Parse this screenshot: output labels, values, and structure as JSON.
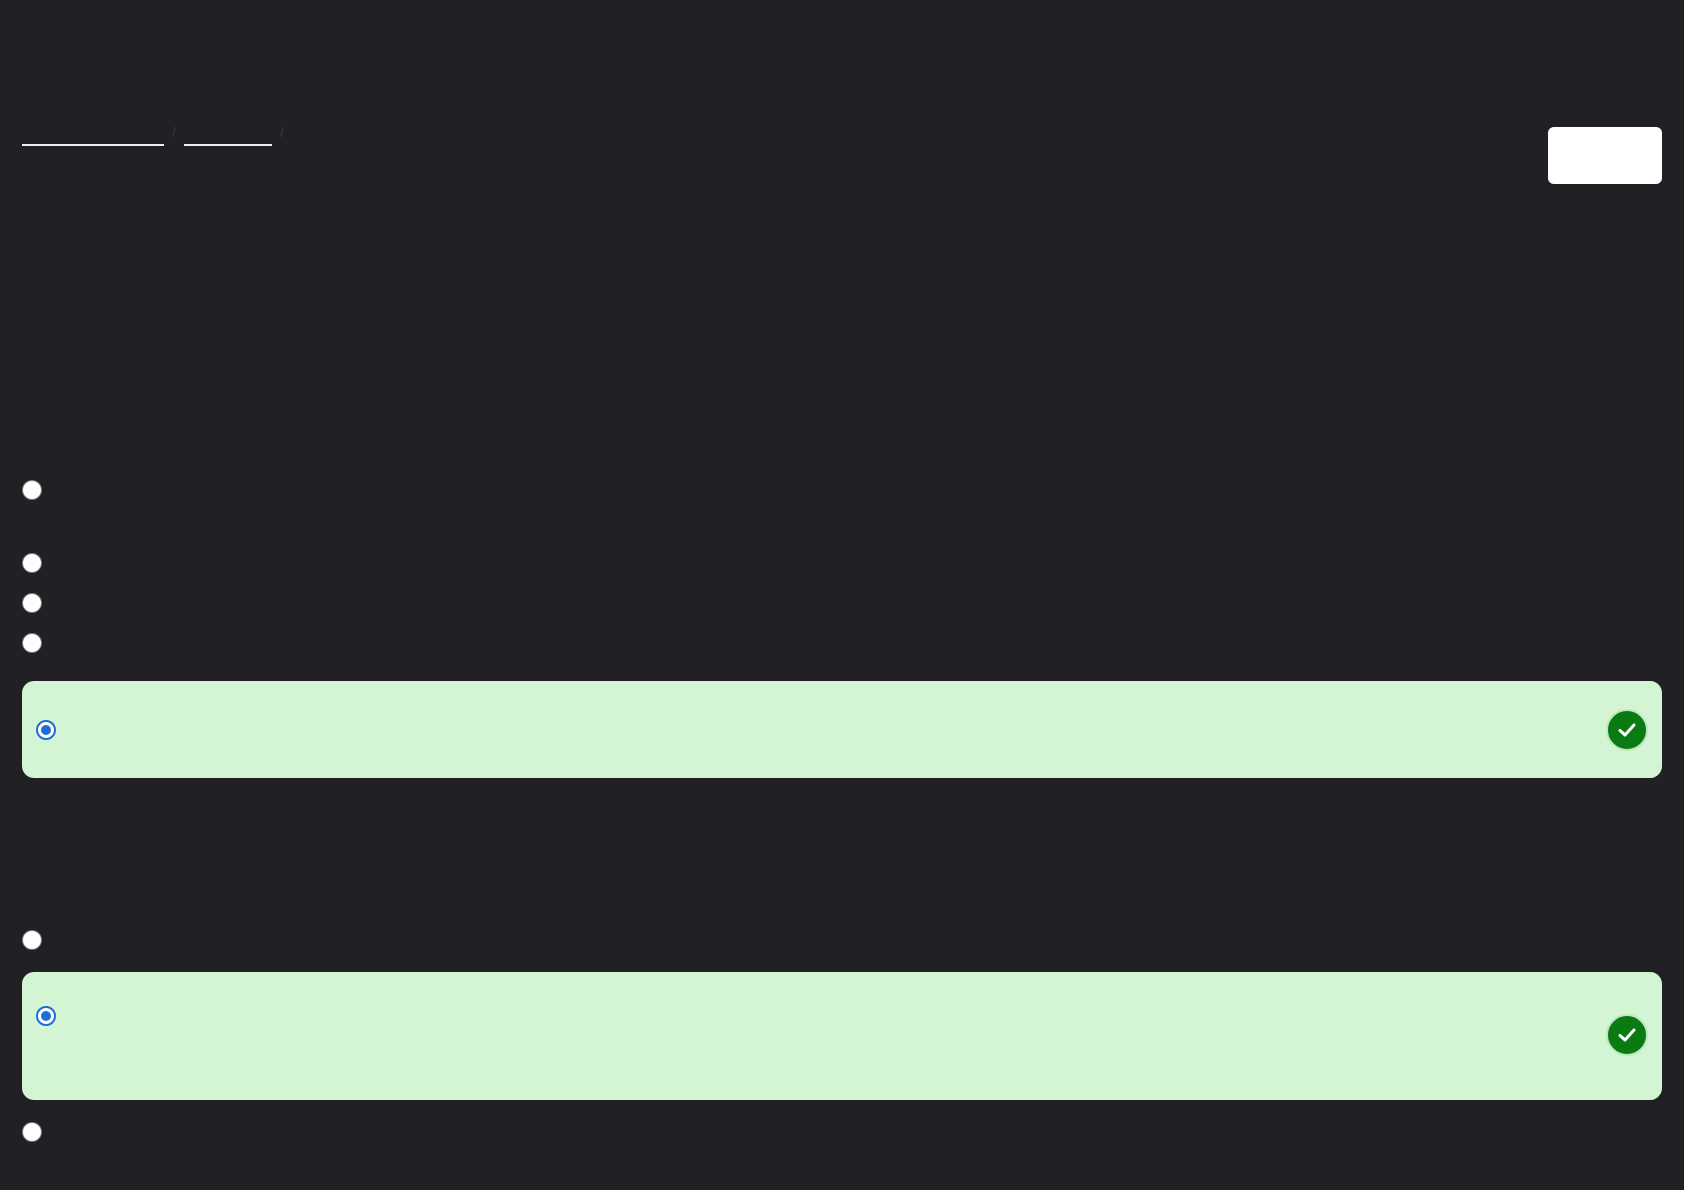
{
  "breadcrumb": {
    "items": [
      {
        "label": ""
      },
      {
        "label": ""
      }
    ],
    "separator": "/"
  },
  "top_button": {
    "label": ""
  },
  "questions": [
    {
      "options": [
        {
          "label": "",
          "selected": false
        },
        {
          "label": "",
          "selected": false
        },
        {
          "label": "",
          "selected": false
        },
        {
          "label": "",
          "selected": false
        },
        {
          "label": "",
          "selected": true,
          "correct": true
        }
      ]
    },
    {
      "options": [
        {
          "label": "",
          "selected": false
        },
        {
          "label": "",
          "selected": true,
          "correct": true
        },
        {
          "label": "",
          "selected": false
        }
      ]
    }
  ],
  "icons": {
    "correct": "check-circle-icon"
  },
  "colors": {
    "background": "#202025",
    "correct_bg": "#d3f5d3",
    "correct_icon": "#0a7b12",
    "selected_radio": "#1c6dd8"
  }
}
